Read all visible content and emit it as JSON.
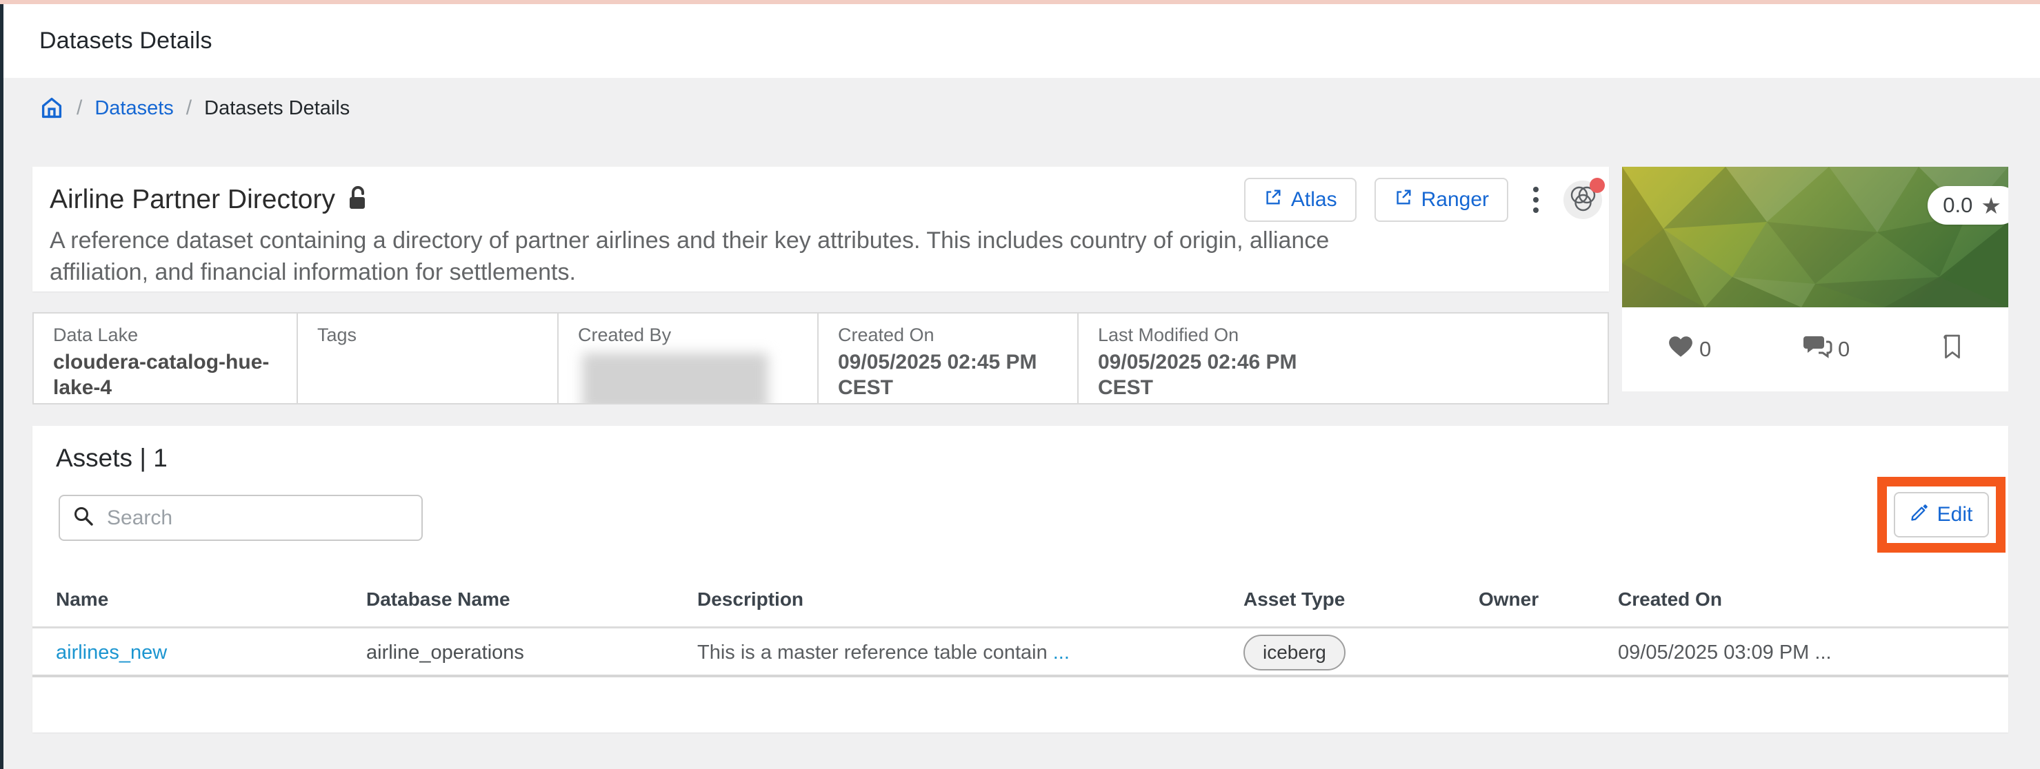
{
  "page": {
    "title": "Datasets Details"
  },
  "breadcrumb": {
    "separator": "/",
    "items": [
      "Datasets",
      "Datasets Details"
    ]
  },
  "dataset": {
    "name": "Airline Partner Directory",
    "description": "A reference dataset containing a directory of partner airlines and their key attributes. This includes country of origin, alliance affiliation, and financial information for settlements.",
    "actions": {
      "atlas": "Atlas",
      "ranger": "Ranger"
    },
    "rating": "0.0",
    "likes": "0",
    "comments": "0",
    "meta": [
      {
        "label": "Data Lake",
        "value": "cloudera-catalog-hue-lake-4"
      },
      {
        "label": "Tags",
        "value": ""
      },
      {
        "label": "Created By",
        "value": "",
        "redacted": true
      },
      {
        "label": "Created On",
        "value": "09/05/2025 02:45 PM CEST"
      },
      {
        "label": "Last Modified On",
        "value": "09/05/2025 02:46 PM CEST"
      }
    ]
  },
  "assets": {
    "title": "Assets | 1",
    "search_placeholder": "Search",
    "edit_label": "Edit",
    "table": {
      "columns": [
        "Name",
        "Database Name",
        "Description",
        "Asset Type",
        "Owner",
        "Created On"
      ],
      "rows": [
        {
          "name": "airlines_new",
          "database": "airline_operations",
          "description": "This is a master reference table contain",
          "description_more": "...",
          "asset_type": "iceberg",
          "owner_redacted": true,
          "created_on": "09/05/2025 03:09 PM ..."
        }
      ]
    }
  },
  "icons": {
    "star": "★"
  },
  "colors": {
    "accent_blue": "#1567d3",
    "asset_link_blue": "#1b95d0",
    "highlight_orange": "#f4581c",
    "notification_red": "#ea5c5c",
    "top_bar_pink": "#f2cdc3",
    "edge_dark": "#1e2d38",
    "thumb_green_left": "#b0ab3b",
    "thumb_green_right": "#4e7c3e"
  }
}
